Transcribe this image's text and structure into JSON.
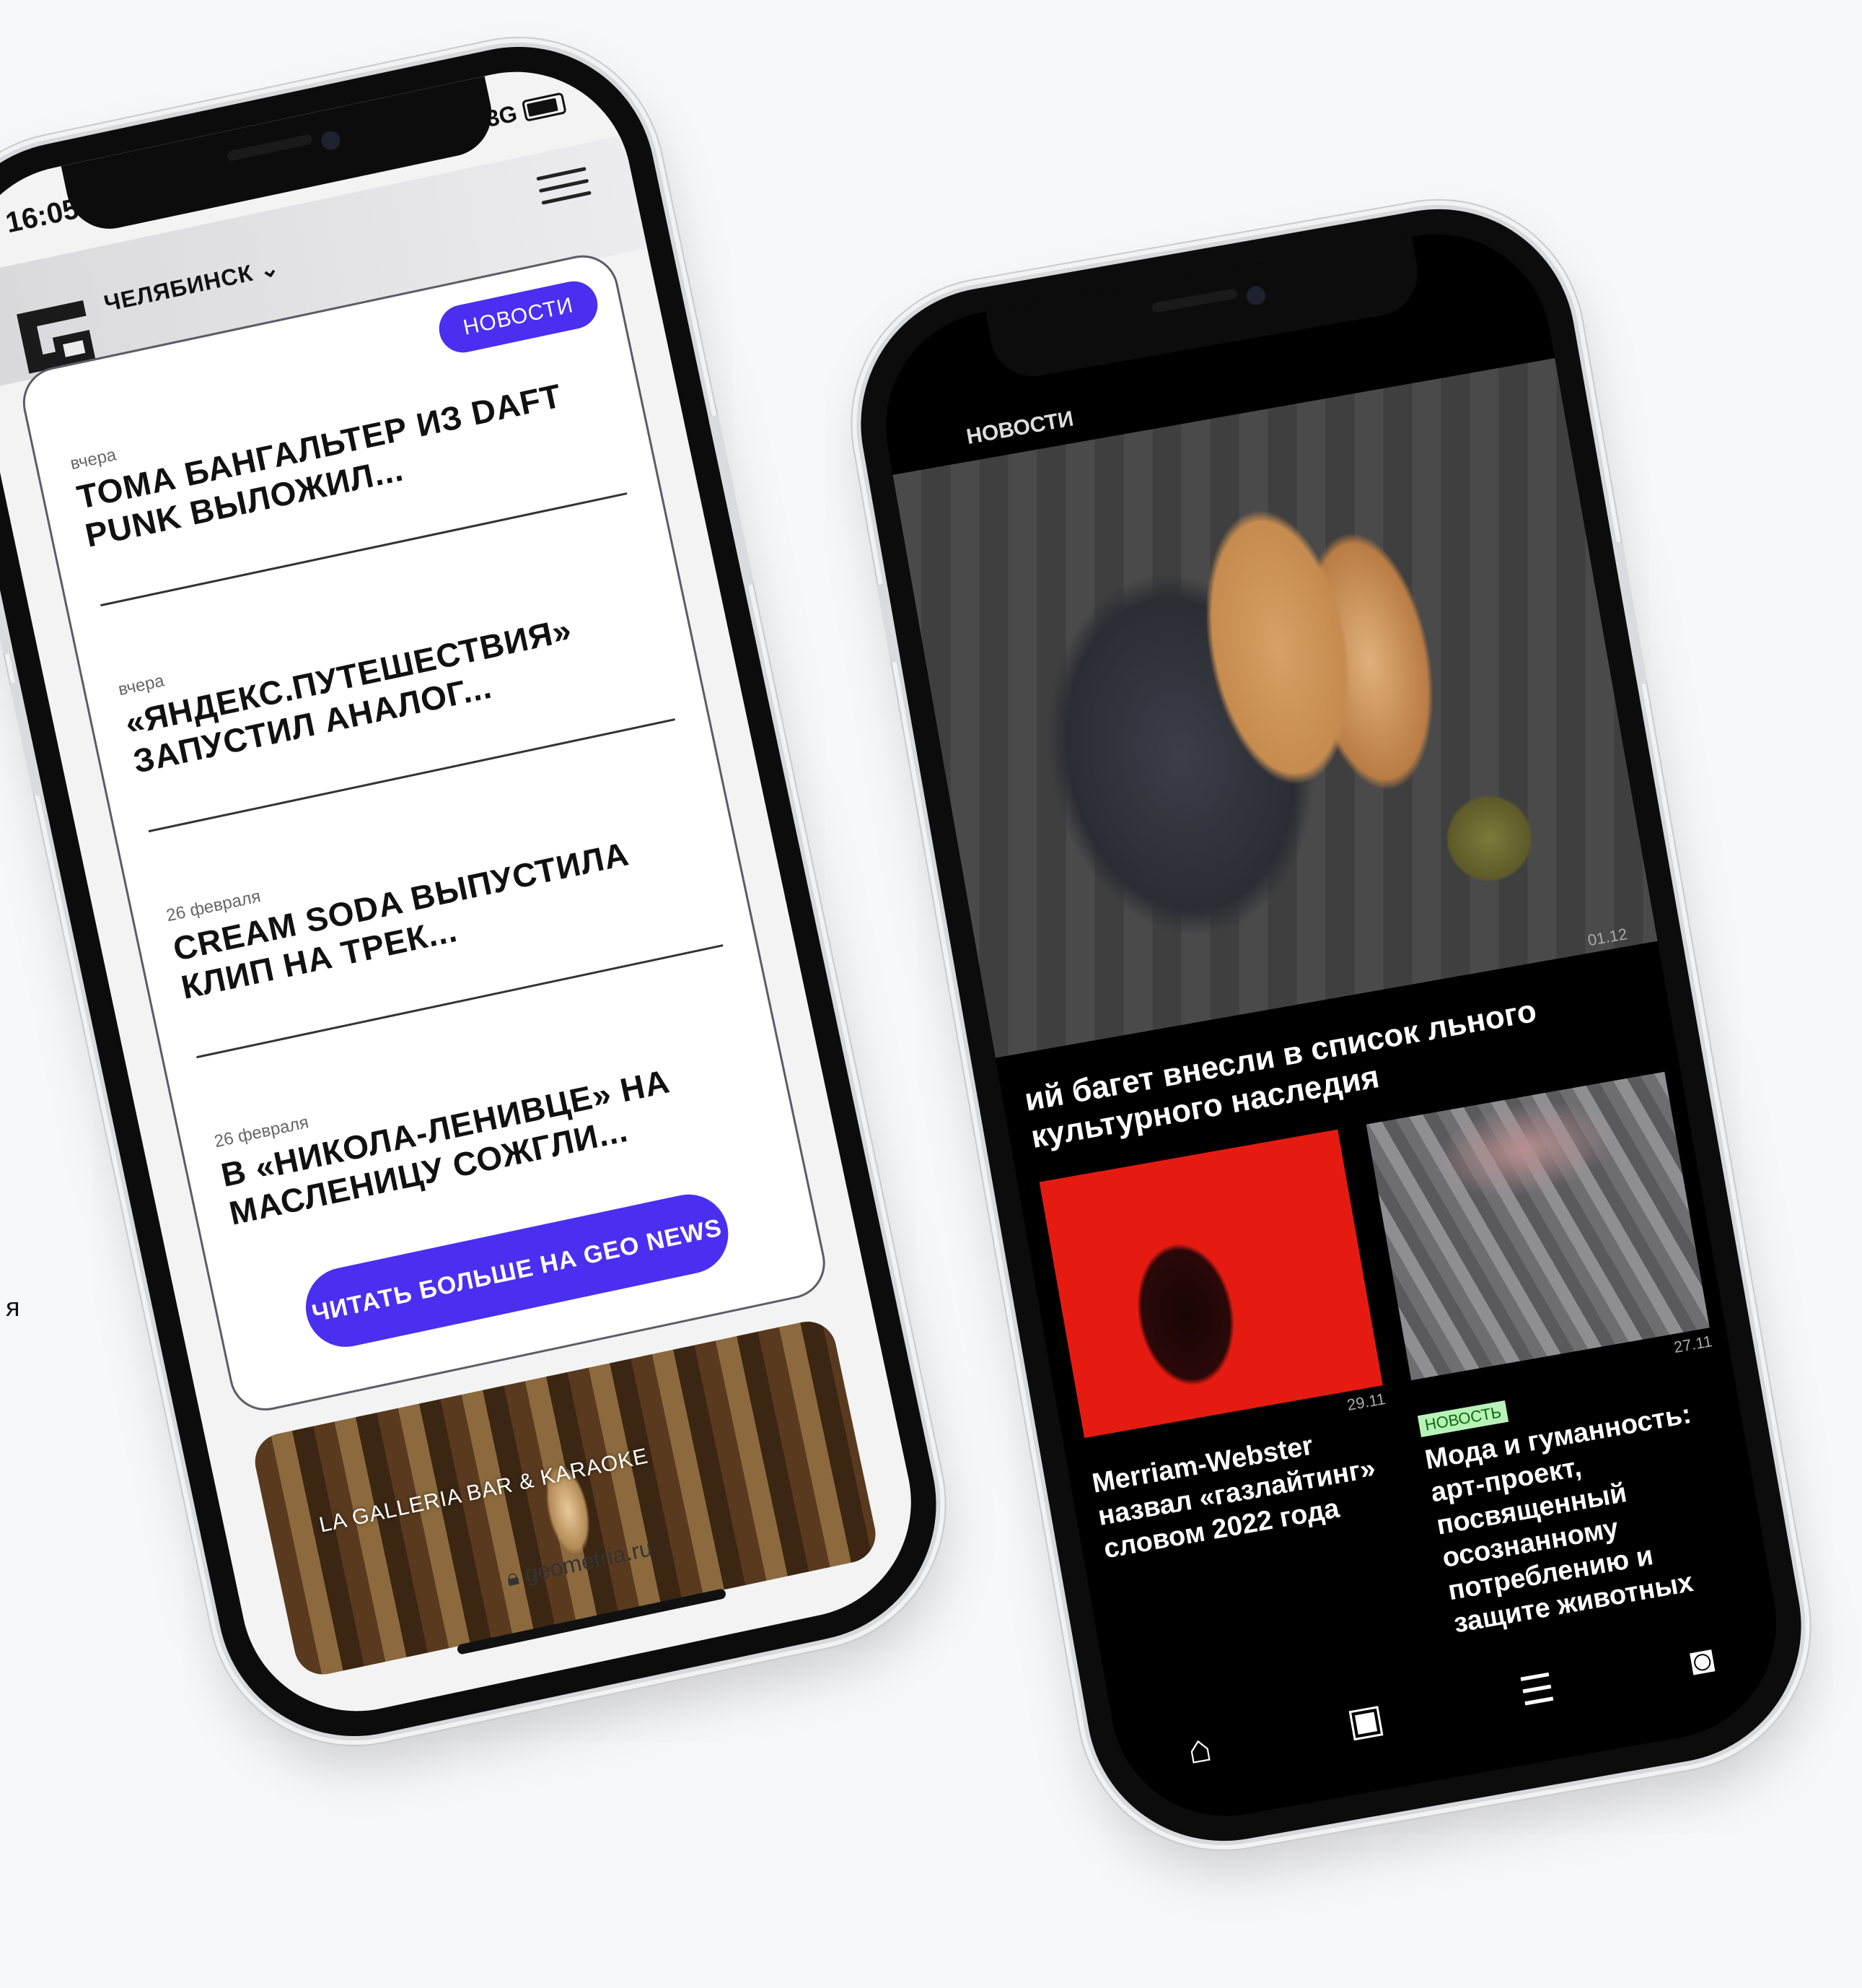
{
  "stray_char": "я",
  "back_phone": {
    "section_label": "НОВОСТИ",
    "hero_date": "01.12",
    "hero_headline": "ий багет внесли в список льного культурного наследия",
    "cards": [
      {
        "date": "29.11",
        "badge": "",
        "title": "Merriam-Webster назвал «газлайтинг» словом 2022 года"
      },
      {
        "date": "27.11",
        "badge": "НОВОСТЬ",
        "title": "Мода и гуманность: арт-проект, посвященный осознанному потреблению и защите животных"
      }
    ],
    "nav_icons": [
      "home-icon",
      "image-icon",
      "news-icon",
      "profile-icon"
    ]
  },
  "front_phone": {
    "time": "16:05",
    "network": "3G",
    "city": "ЧЕЛЯБИНСК",
    "section_pill": "НОВОСТИ",
    "news": [
      {
        "date": "вчера",
        "title": "ТОМА БАНГАЛЬТЕР ИЗ DAFT PUNK ВЫЛОЖИЛ..."
      },
      {
        "date": "вчера",
        "title": "«ЯНДЕКС.ПУТЕШЕСТВИЯ» ЗАПУСТИЛ АНАЛОГ..."
      },
      {
        "date": "26 февраля",
        "title": "CREAM SODA ВЫПУСТИЛА КЛИП НА ТРЕК..."
      },
      {
        "date": "26 февраля",
        "title": "В «НИКОЛА-ЛЕНИВЦЕ» НА МАСЛЕНИЦУ СОЖГЛИ..."
      }
    ],
    "cta": "ЧИТАТЬ БОЛЬШЕ НА GEO NEWS",
    "promo_title": "LA GALLERIA BAR & KARAOKE",
    "url": "geometria.ru"
  },
  "colors": {
    "accent": "#4a2ff0",
    "badge_bg": "#b8f2b8",
    "background": "#f7f8fa"
  }
}
